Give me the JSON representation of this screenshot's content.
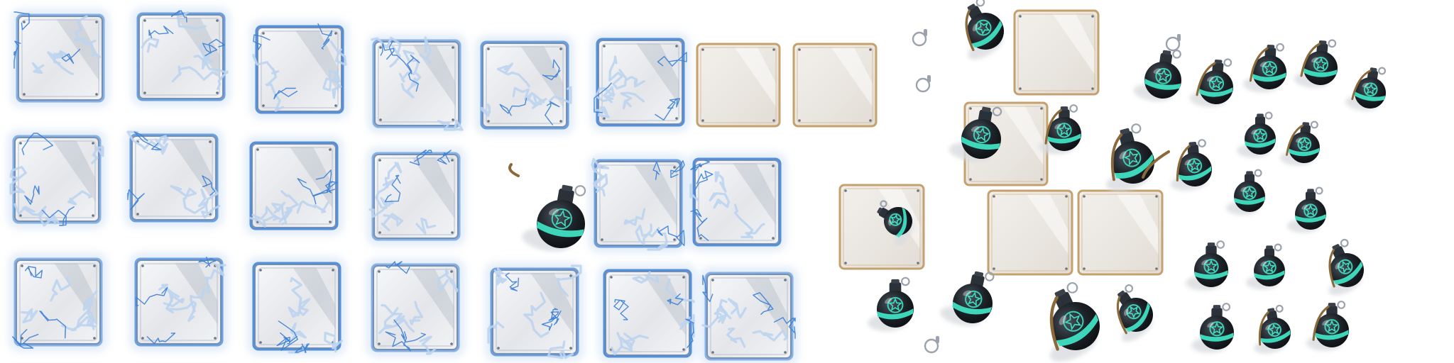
{
  "sprite_sheet": {
    "frame_colors": {
      "electric_outer": "#3b7fd6",
      "electric_inner": "#bcd4ee",
      "glass_fill": "#e6e8ec",
      "glass_highlight": "#ffffff",
      "wood_border": "#c4a16f",
      "wood_fill": "#ece8e2",
      "glow": "#a9c7ea"
    },
    "grenade_colors": {
      "body": "#1e2329",
      "cap": "#2b3138",
      "band": "#3fe0c2",
      "lever": "#8a6a3a",
      "ring": "#9aa3ad",
      "shadow": "#d9dcdf"
    },
    "icons": {
      "frame": "frame-icon",
      "grenade": "grenade-icon",
      "pin_ring": "pin-ring-icon",
      "lever": "lever-icon"
    },
    "frame_groups": {
      "electric_frames": 20,
      "wood_frames": 7
    },
    "grenade_sprite_count": 24,
    "loose_pin_rings": 4
  }
}
